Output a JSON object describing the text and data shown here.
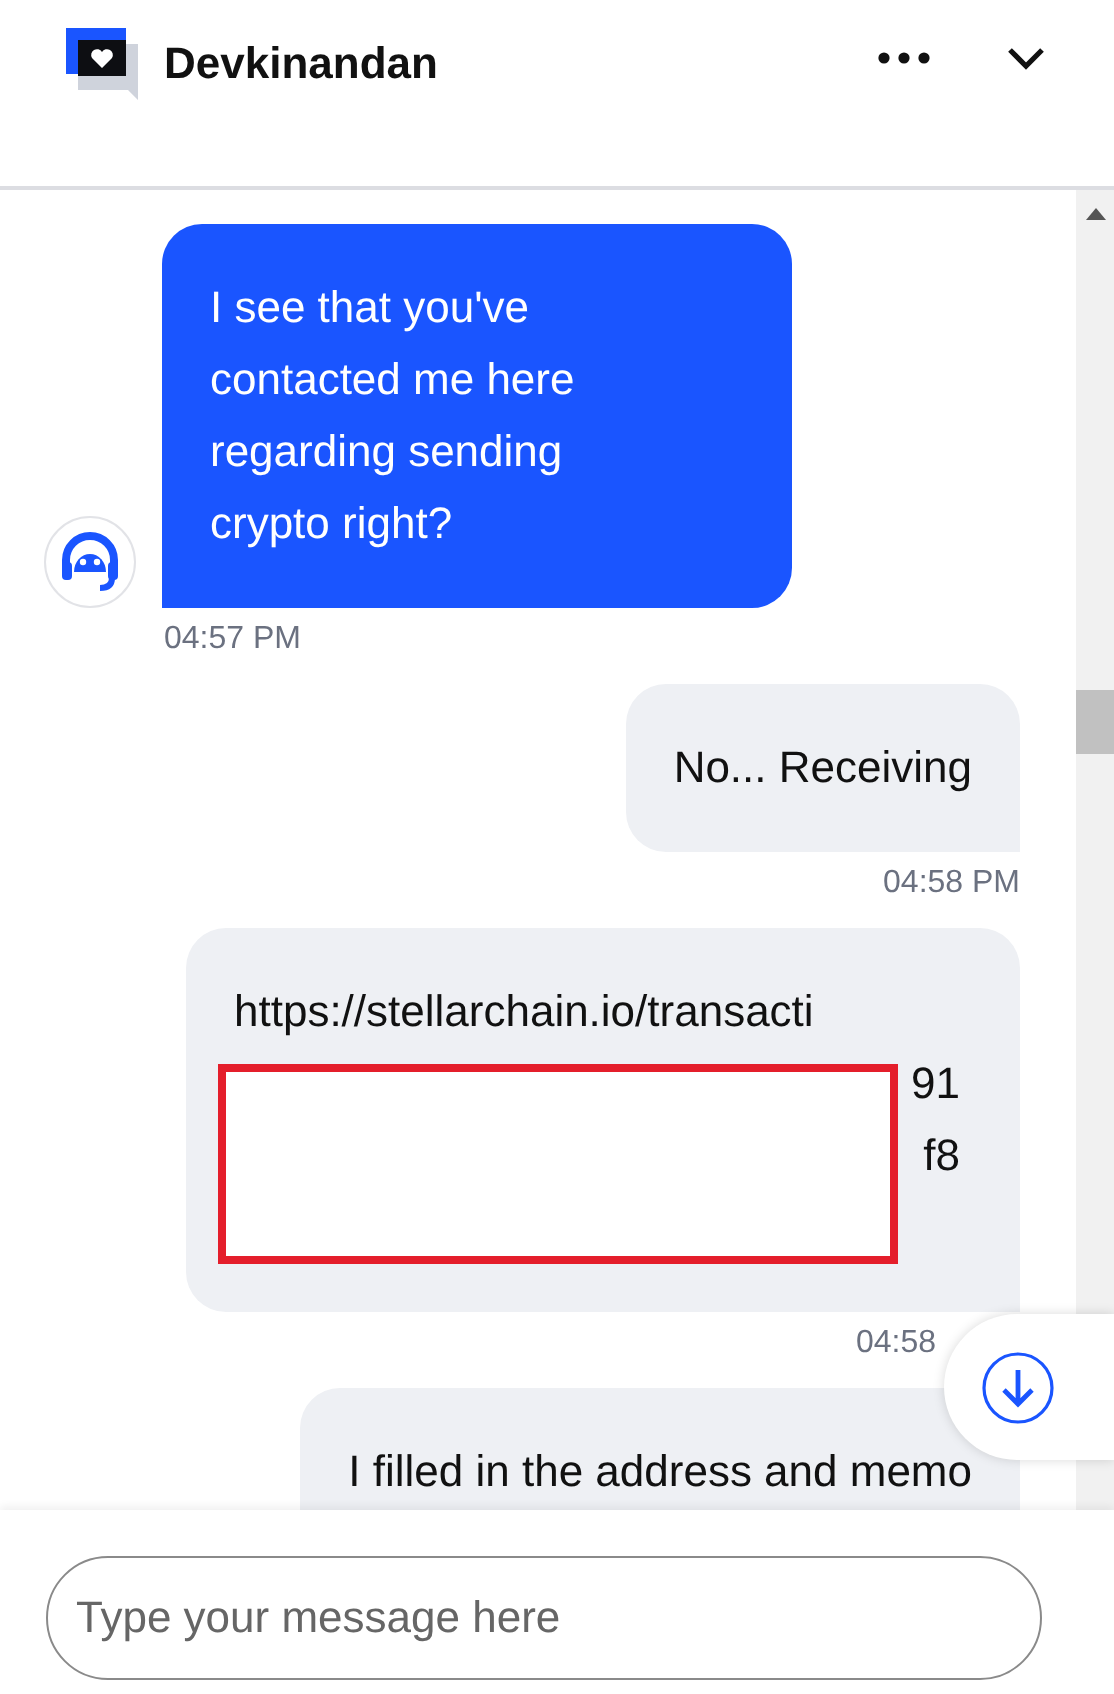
{
  "header": {
    "title": "Devkinandan"
  },
  "messages": [
    {
      "kind": "agent",
      "lines": [
        "I see that you've contacted me here regarding sending crypto right?"
      ],
      "redacted": false
    },
    {
      "kind": "agent_time",
      "text": "04:57 PM"
    },
    {
      "kind": "user",
      "lines": [
        "No... Receiving"
      ],
      "redacted": false
    },
    {
      "kind": "user_time",
      "text": "04:58 PM"
    },
    {
      "kind": "user",
      "lines": [
        "https://stellarchain.io/transacti",
        "91",
        "f8"
      ],
      "redacted": true
    },
    {
      "kind": "user_time",
      "text": "04:58"
    },
    {
      "kind": "user",
      "lines": [
        "I filled in the address and memo"
      ],
      "redacted": false
    }
  ],
  "composer": {
    "placeholder": "Type your message here"
  }
}
